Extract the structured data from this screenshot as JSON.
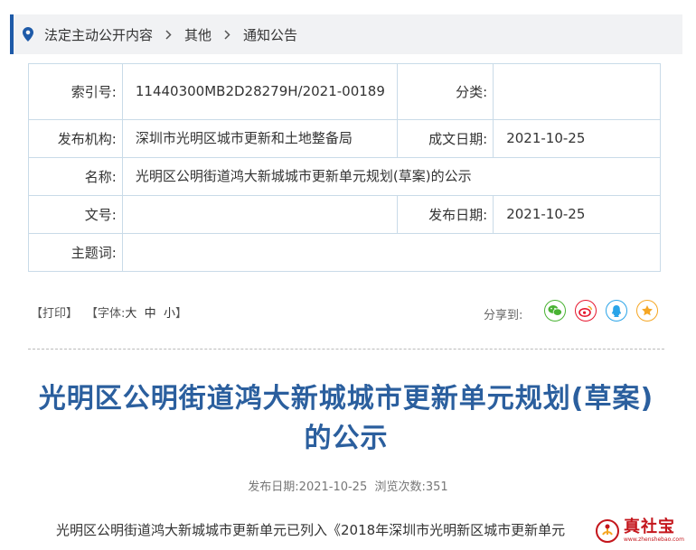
{
  "breadcrumb": {
    "items": [
      "法定主动公开内容",
      "其他",
      "通知公告"
    ]
  },
  "info": {
    "index_label": "索引号:",
    "index_value": "11440300MB2D28279H/2021-00189",
    "category_label": "分类:",
    "category_value": "",
    "publisher_label": "发布机构:",
    "publisher_value": "深圳市光明区城市更新和土地整备局",
    "created_label": "成文日期:",
    "created_value": "2021-10-25",
    "name_label": "名称:",
    "name_value": "光明区公明街道鸿大新城城市更新单元规划(草案)的公示",
    "docno_label": "文号:",
    "docno_value": "",
    "pubdate_label": "发布日期:",
    "pubdate_value": "2021-10-25",
    "keywords_label": "主题词:",
    "keywords_value": ""
  },
  "toolbar": {
    "print": "【打印】",
    "font_prefix": "【字体:",
    "font_large": "大",
    "font_medium": "中",
    "font_small": "小",
    "font_suffix": "】",
    "share_label": "分享到:"
  },
  "share": {
    "wechat_color": "#49b233",
    "weibo_color": "#e6162d",
    "qq_color": "#2aa4e8",
    "favorite_color": "#f5a623"
  },
  "article": {
    "title": "光明区公明街道鸿大新城城市更新单元规划(草案)的公示",
    "meta": "发布日期:2021-10-25  浏览次数:351",
    "body": "光明区公明街道鸿大新城城市更新单元已列入《2018年深圳市光明新区城市更新单元"
  },
  "watermark": {
    "text": "真社宝",
    "url": "www.zhenshebao.com"
  }
}
